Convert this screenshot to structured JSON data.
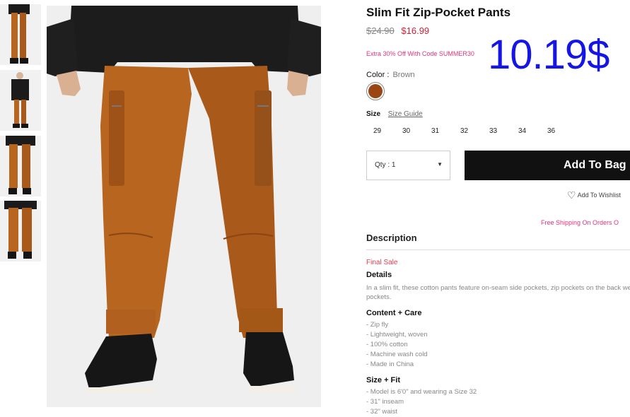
{
  "thumbnails": [
    {
      "name": "thumbnail-front-crop"
    },
    {
      "name": "thumbnail-full-front"
    },
    {
      "name": "thumbnail-front-pants"
    },
    {
      "name": "thumbnail-back-pants"
    }
  ],
  "product": {
    "title": "Slim Fit Zip-Pocket Pants",
    "price_original": "$24.90",
    "price_sale": "$16.99",
    "promo": "Extra 30% Off With Code SUMMER30",
    "overlay_price": "10.19$",
    "color_label": "Color :",
    "color_value": "Brown",
    "swatch_color": "#9a4513",
    "size_label": "Size",
    "size_guide": "Size Guide",
    "sizes": [
      "29",
      "30",
      "31",
      "32",
      "33",
      "34",
      "36"
    ],
    "qty_label": "Qty : 1",
    "add_to_bag": "Add To Bag",
    "wishlist": "Add To Wishlist",
    "shipping": "Free Shipping On Orders O"
  },
  "description": {
    "heading": "Description",
    "final_sale": "Final Sale",
    "details_heading": "Details",
    "details_text": "In a slim fit, these cotton pants feature on-seam side pockets, zip pockets on the back welt pockets.",
    "content_heading": "Content + Care",
    "content_items": [
      "- Zip fly",
      "- Lightweight, woven",
      "- 100% cotton",
      "- Machine wash cold",
      "- Made in China"
    ],
    "size_heading": "Size + Fit",
    "size_items": [
      "- Model is 6'0\" and wearing a Size 32",
      "- 31\" inseam",
      "- 32\" waist"
    ]
  },
  "colors": {
    "accent_red": "#d0213a",
    "promo_pink": "#e0357d",
    "overlay_blue": "#1515e6",
    "pants_brown": "#b8651f",
    "button_black": "#111111"
  }
}
